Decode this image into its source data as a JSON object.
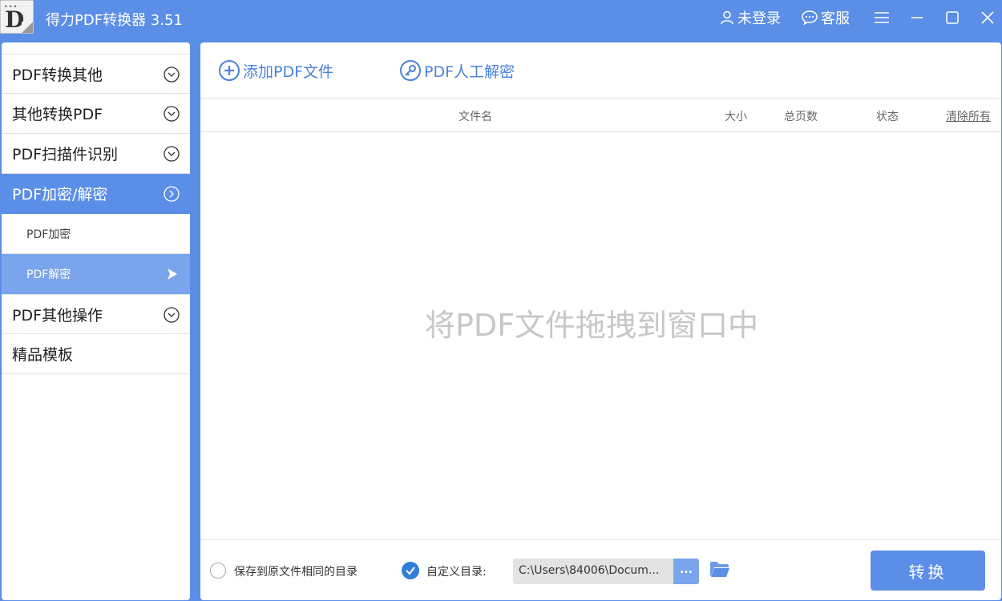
{
  "window": {
    "title": "得力PDF转换器 3.51",
    "icon_letter": "D",
    "icon_dots": "•••"
  },
  "titlebar": {
    "login_label": "未登录",
    "service_label": "客服"
  },
  "sidebar": {
    "items": [
      {
        "label": "PDF转换其他"
      },
      {
        "label": "其他转换PDF"
      },
      {
        "label": "PDF扫描件识别"
      },
      {
        "label": "PDF加密/解密",
        "active": true
      },
      {
        "label": "PDF其他操作"
      },
      {
        "label": "精品模板"
      }
    ],
    "subitems": [
      {
        "label": "PDF加密"
      },
      {
        "label": "PDF解密",
        "selected": true
      }
    ]
  },
  "toolbar": {
    "add_label": "添加PDF文件",
    "manual_label": "PDF人工解密"
  },
  "table": {
    "columns": {
      "filename": "文件名",
      "size": "大小",
      "pages": "总页数",
      "status": "状态",
      "clear": "清除所有"
    }
  },
  "drop_hint": "将PDF文件拖拽到窗口中",
  "footer": {
    "same_dir_label": "保存到原文件相同的目录",
    "custom_dir_label": "自定义目录:",
    "path_value": "C:\\Users\\84006\\Docum...",
    "browse_label": "...",
    "convert_label": "转换"
  },
  "colors": {
    "accent": "#5b8ee6",
    "accent_light": "#7aa4ec",
    "toolbar_text": "#4a82dd",
    "check": "#2f7fd8"
  }
}
